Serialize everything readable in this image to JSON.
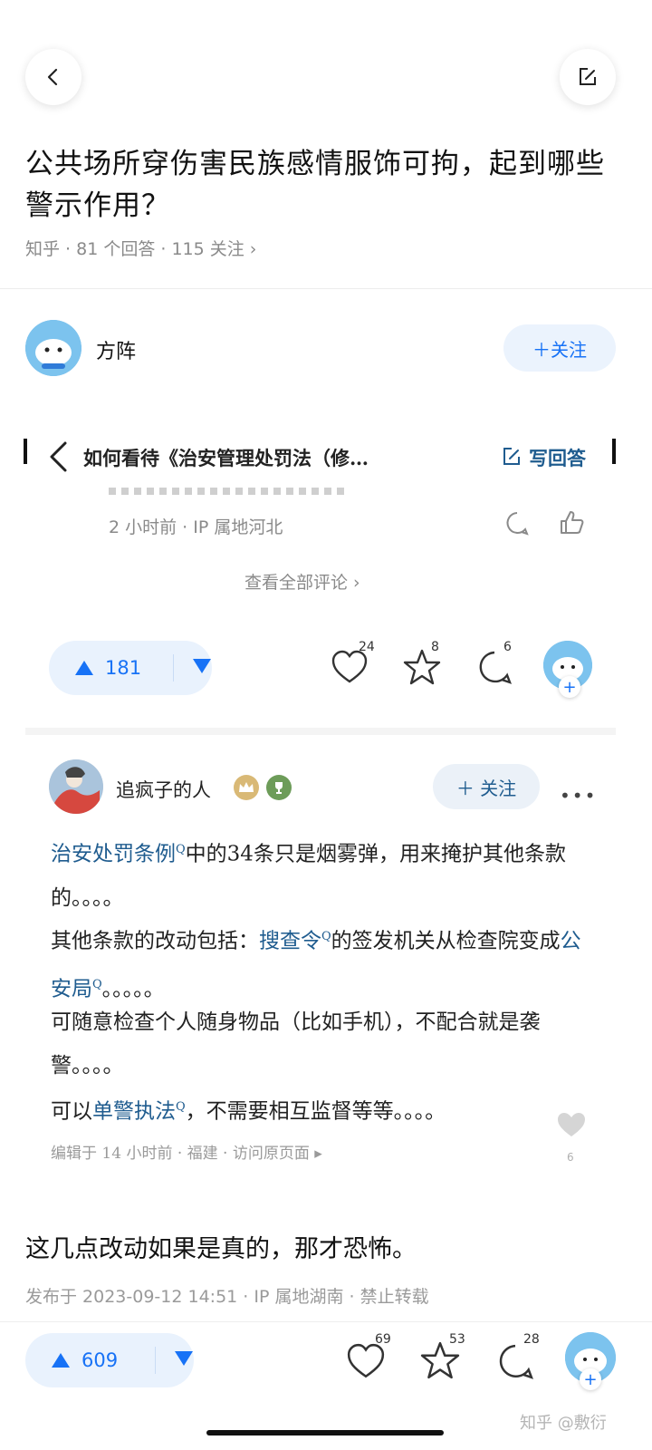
{
  "header": {
    "back_icon": "chevron-left-icon",
    "compose_icon": "edit-square-icon"
  },
  "question": {
    "title": "公共场所穿伤害民族感情服饰可拘，起到哪些警示作用？",
    "meta": "知乎 · 81 个回答 · 115 关注 ›"
  },
  "author": {
    "name": "方阵",
    "follow_label": "＋关注"
  },
  "embedded": {
    "nav_title": "如何看待《治安管理处罚法（修…",
    "write_answer": "写回答",
    "comment_time": "2 小时前 · IP 属地河北",
    "view_all_comments": "查看全部评论 ›",
    "upvote_count": "181",
    "like_count": "24",
    "star_count": "8",
    "comment_count": "6",
    "answer_user": "追疯子的人",
    "answer_follow": "＋ 关注",
    "paragraphs": [
      {
        "link1": "治安处罚条例",
        "rest1": "中的34条只是烟雾弹，用来掩护其他条款的。。。。"
      },
      {
        "pre": "其他条款的改动包括：",
        "link1": "搜查令",
        "mid": "的签发机关从检查院变成",
        "link2": "公安局",
        "post": "。。。。。"
      },
      {
        "text": "可随意检查个人随身物品（比如手机），不配合就是袭警。。。。"
      },
      {
        "pre": "可以",
        "link1": "单警执法",
        "post": "，不需要相互监督等等。。。。"
      }
    ],
    "edit_meta": "编辑于 14 小时前 · 福建 · 访问原页面 ▸",
    "small_like_count": "6"
  },
  "answer_body": "这几点改动如果是真的，那才恐怖。",
  "publish_meta": "发布于 2023-09-12 14:51 · IP 属地湖南 · 禁止转载",
  "bottom_bar": {
    "upvote_count": "609",
    "like_count": "69",
    "star_count": "53",
    "comment_count": "28"
  },
  "watermark": "知乎 @敷衍",
  "colors": {
    "accent": "#1772f6",
    "link": "#1f5c8f",
    "vote_bg": "#e9f2fd"
  }
}
